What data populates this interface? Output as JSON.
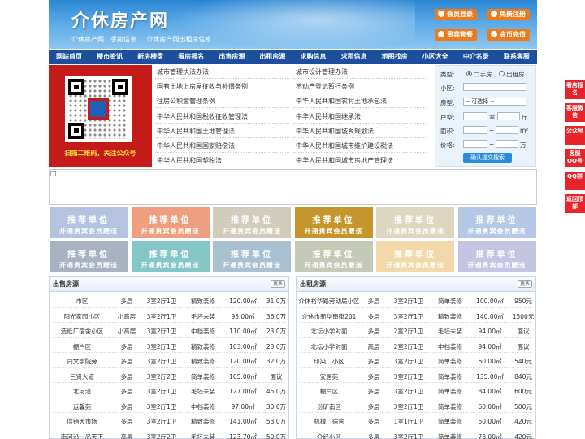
{
  "header": {
    "logo": "介休房产网",
    "slogan": [
      "介休房产网二手房信息",
      "介休房产网出租房信息"
    ],
    "buttons": [
      "会员登录",
      "免费注册",
      "贵宾套餐",
      "金币充值"
    ]
  },
  "nav": [
    "网站首页",
    "楼市资讯",
    "新房楼盘",
    "看房报名",
    "出售房源",
    "出租房源",
    "求购信息",
    "求租信息",
    "地图找房",
    "小区大全",
    "中介名录",
    "联系客服"
  ],
  "qr_caption": "扫描二维码，关注公众号",
  "law_links": [
    [
      "城市管理执法办法",
      "城市设计管理办法"
    ],
    [
      "国有土地上房屋征收与补偿条例",
      "不动产登记暂行条例"
    ],
    [
      "住房公积金管理条例",
      "中华人民共和国农村土地承包法"
    ],
    [
      "中华人民共和国税收征收管理法",
      "中华人民共和国继承法"
    ],
    [
      "中华人民共和国土地管理法",
      "中华人民共和国城乡规划法"
    ],
    [
      "中华人民共和国国家赔偿法",
      "中华人民共和国城市维护建设税法"
    ],
    [
      "中华人民共和国契税法",
      "中华人民共和国城市房地产管理法"
    ]
  ],
  "search": {
    "type_label": "类型:",
    "type_options": [
      "二手房",
      "出租房"
    ],
    "community_label": "小区:",
    "housetype_label": "房型:",
    "housetype_select": "-- 可选择 --",
    "layout_label": "户型:",
    "room_unit": "室",
    "hall_unit": "厅",
    "area_label": "面积:",
    "area_unit": "m²",
    "price_label": "价格:",
    "price_unit": "万",
    "submit": "确认提交搜索"
  },
  "ads": {
    "title": "推荐单位",
    "subtitle": "开通贵宾会员赠送",
    "colors": [
      "#b4c4e0",
      "#f09e80",
      "#d2ccbd",
      "#c5962b",
      "#ddd6c0",
      "#b5c8e6",
      "#a9b2c1",
      "#85c6c6",
      "#a8c0d0",
      "#c5cab6",
      "#f3d9a9",
      "#c4c5e2"
    ]
  },
  "sale": {
    "title": "出售房源",
    "more": "更多",
    "rows": [
      [
        "市区",
        "多层",
        "3室2厅1卫",
        "精致装修",
        "120.00㎡",
        "31.0万"
      ],
      [
        "阳光家园小区",
        "小高层",
        "3室2厅1卫",
        "毛坯未装",
        "95.00㎡",
        "36.0万"
      ],
      [
        "造纸厂宿舍小区",
        "小高层",
        "3室2厅1卫",
        "中档装修",
        "110.00㎡",
        "23.0万"
      ],
      [
        "棚户区",
        "多层",
        "3室2厅1卫",
        "精致装修",
        "103.00㎡",
        "23.0万"
      ],
      [
        "同文学院旁",
        "多层",
        "3室2厅1卫",
        "精致装修",
        "120.00㎡",
        "32.0万"
      ],
      [
        "三贤大道",
        "多层",
        "3室2厅2卫",
        "简单装修",
        "105.00㎡",
        "面议"
      ],
      [
        "北河沿",
        "多层",
        "3室2厅1卫",
        "毛坯未装",
        "127.00㎡",
        "45.0万"
      ],
      [
        "运馨苑",
        "多层",
        "3室2厅1卫",
        "中档装修",
        "97.00㎡",
        "30.0万"
      ],
      [
        "供销大市场",
        "多层",
        "3室2厅1卫",
        "精致装修",
        "141.00㎡",
        "53.0万"
      ],
      [
        "南河沿一品天下",
        "高层",
        "3室2厅2卫",
        "毛坯未装",
        "123.70㎡",
        "50.0万"
      ]
    ]
  },
  "rent": {
    "title": "出租房源",
    "more": "更多",
    "rows": [
      [
        "介休裕华路劳动局小区",
        "多层",
        "3室2厅1卫",
        "简单装修",
        "100.00㎡",
        "950元"
      ],
      [
        "介休市新华南街201",
        "多层",
        "3室2厅1卫",
        "精致装修",
        "140.00㎡",
        "1500元"
      ],
      [
        "北坛小学对面",
        "多层",
        "2室2厅1卫",
        "毛坯未装",
        "94.00㎡",
        "面议"
      ],
      [
        "北坛小学对面",
        "高层",
        "2室2厅1卫",
        "中档装修",
        "94.00㎡",
        "面议"
      ],
      [
        "印染厂小区",
        "多层",
        "3室2厅1卫",
        "简单装修",
        "60.00㎡",
        "540元"
      ],
      [
        "安居苑",
        "多层",
        "3室2厅1卫",
        "简单装修",
        "135.00㎡",
        "840元"
      ],
      [
        "棚户区",
        "多层",
        "3室2厅1卫",
        "简单装修",
        "84.00㎡",
        "600元"
      ],
      [
        "汾矿南区",
        "多层",
        "3室2厅1卫",
        "简单装修",
        "60.00㎡",
        "500元"
      ],
      [
        "机械厂宿舍",
        "多层",
        "1室1厅1卫",
        "简单装修",
        "50.00㎡",
        "420元"
      ],
      [
        "介经小区",
        "多层",
        "3室2厅1卫",
        "简单装修",
        "78.00㎡",
        "420元"
      ]
    ]
  },
  "side_buttons": [
    "看房报名",
    "客服微信",
    "公众号",
    "客服QQ号",
    "QQ群",
    "返回顶部"
  ]
}
